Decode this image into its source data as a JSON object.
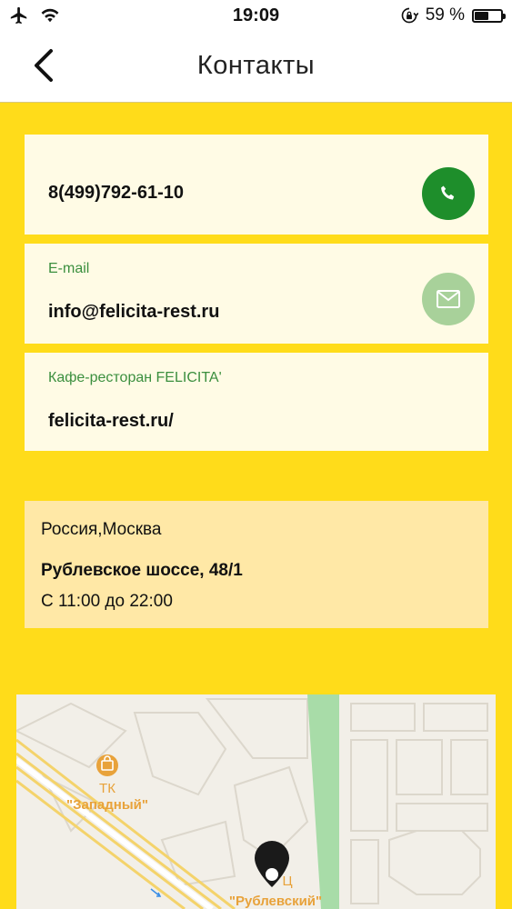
{
  "status_bar": {
    "time": "19:09",
    "battery_text": "59 %",
    "battery_level": 0.59,
    "icons": [
      "airplane-icon",
      "wifi-icon",
      "rotation-lock-icon",
      "battery-icon"
    ]
  },
  "nav": {
    "title": "Контакты",
    "back_icon": "chevron-left-icon"
  },
  "contacts": {
    "phone": {
      "value": "8(499)792-61-10",
      "button_icon": "phone-icon",
      "button_color": "#1E8E2B"
    },
    "email": {
      "label": "E-mail",
      "value": "info@felicita-rest.ru",
      "button_icon": "envelope-icon",
      "button_color": "#A8D19A"
    },
    "website": {
      "label": "Кафе-ресторан FELICITA'",
      "value": "felicita-rest.ru/"
    }
  },
  "address": {
    "city": "Россия,Москва",
    "street": "Рублевское шоссе, 48/1",
    "hours": "С 11:00 до 22:00"
  },
  "map": {
    "poi_1_line1": "ТК",
    "poi_1_line2": "\"Западный\"",
    "poi_2_line1": "Ц",
    "poi_2_line2": "\"Рублевский\"",
    "marker_icon": "map-pin-icon",
    "poi_icon": "shopping-icon"
  },
  "colors": {
    "background": "#FFDC1A",
    "card": "#FFFBE5",
    "address_card": "#FFE8A6",
    "label_green": "#3B8F3E",
    "poi_orange": "#E8A23A"
  }
}
